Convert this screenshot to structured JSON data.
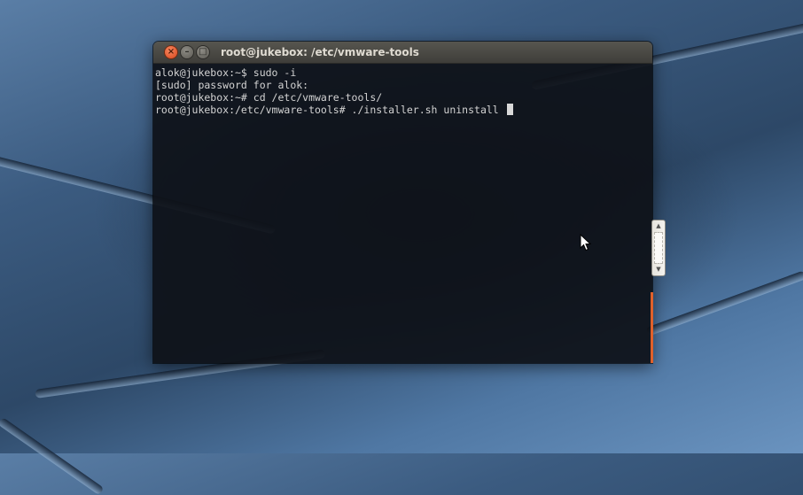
{
  "window": {
    "title": "root@jukebox: /etc/vmware-tools",
    "buttons": {
      "close_glyph": "×",
      "minimize_glyph": "–",
      "maximize_glyph": "□"
    }
  },
  "terminal": {
    "lines": [
      "alok@jukebox:~$ sudo -i",
      "[sudo] password for alok:",
      "root@jukebox:~# cd /etc/vmware-tools/",
      "root@jukebox:/etc/vmware-tools# ./installer.sh uninstall "
    ]
  },
  "scrollbar": {
    "up_glyph": "▲",
    "down_glyph": "▼"
  },
  "colors": {
    "accent": "#e0602a",
    "terminal_bg": "#0e1118",
    "terminal_fg": "#d3d3d3"
  },
  "icons": {
    "cursor": "mouse-pointer-icon"
  }
}
